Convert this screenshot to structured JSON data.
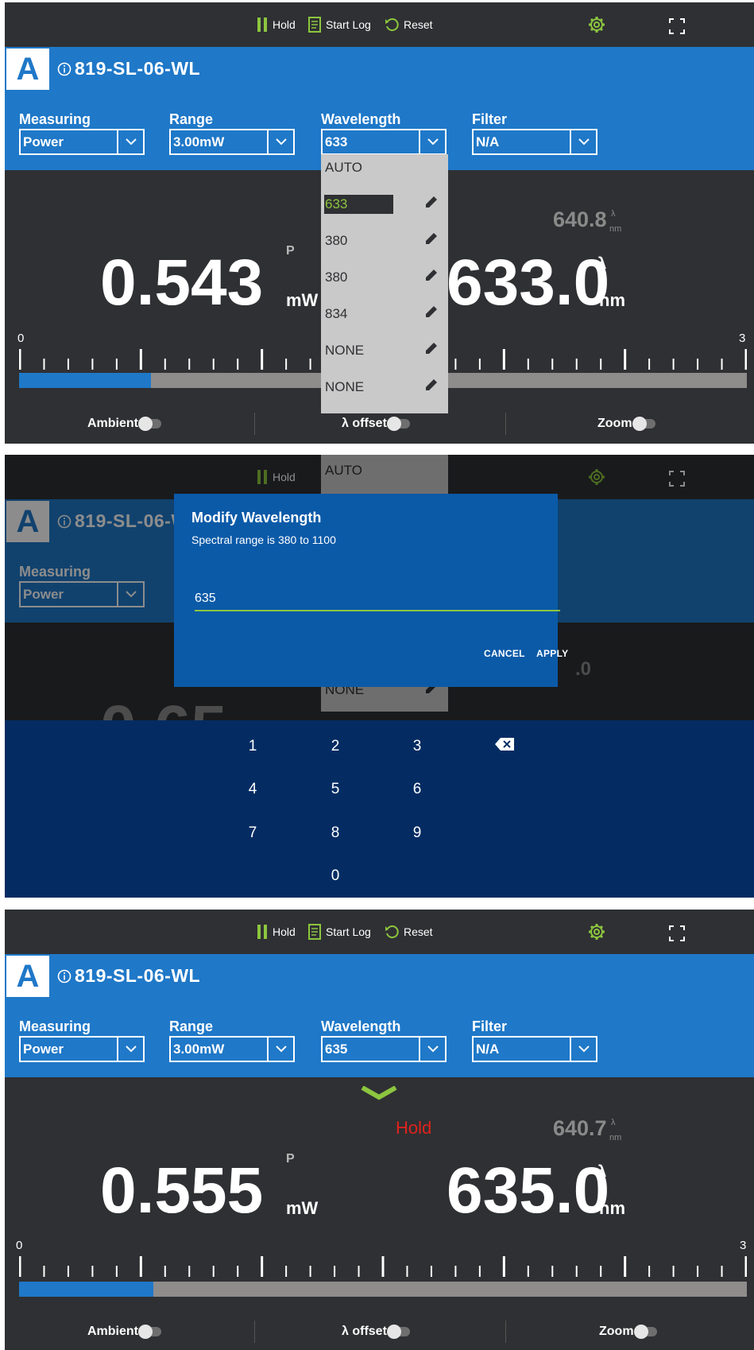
{
  "toolbar": {
    "hold_label": "Hold",
    "start_log_label": "Start Log",
    "reset_label": "Reset"
  },
  "colors": {
    "brand_blue": "#1f78c8",
    "accent_green": "#8cc63f",
    "background": "#2f3033",
    "hold_red": "#e0231b"
  },
  "header": {
    "logo_letter": "A",
    "device_name": "819-SL-06-WL",
    "labels": {
      "measuring": "Measuring",
      "range": "Range",
      "wavelength": "Wavelength",
      "filter": "Filter"
    }
  },
  "screen1": {
    "selects": {
      "measuring": "Power",
      "range": "3.00mW",
      "wavelength": "633",
      "filter": "N/A"
    },
    "power_reading": "0.543",
    "power_unit": "mW",
    "power_marker": "P",
    "wavelength_reading": "633.0",
    "wavelength_unit": "nm",
    "wavelength_marker": "λ",
    "secondary_reading": "640.8",
    "secondary_unit": "nm",
    "secondary_marker": "λ",
    "wavelength_options": [
      "AUTO",
      "633",
      "380",
      "380",
      "834",
      "NONE",
      "NONE"
    ],
    "scale_min": "0",
    "scale_max": "3",
    "bar_fraction": 0.181
  },
  "screen2": {
    "selects": {
      "measuring": "Power"
    },
    "background_dropdown_top": "AUTO",
    "background_dropdown_item": "NONE",
    "secondary_fragment": ".0",
    "dialog": {
      "title": "Modify Wavelength",
      "subtitle": "Spectral range is 380 to 1100",
      "input_value": "635",
      "cancel_label": "CANCEL",
      "apply_label": "APPLY"
    },
    "keypad": {
      "keys": [
        "1",
        "2",
        "3",
        "4",
        "5",
        "6",
        "7",
        "8",
        "9",
        "0"
      ]
    }
  },
  "screen3": {
    "selects": {
      "measuring": "Power",
      "range": "3.00mW",
      "wavelength": "635",
      "filter": "N/A"
    },
    "hold_status": "Hold",
    "power_reading": "0.555",
    "power_unit": "mW",
    "power_marker": "P",
    "wavelength_reading": "635.0",
    "wavelength_unit": "nm",
    "wavelength_marker": "λ",
    "secondary_reading": "640.7",
    "secondary_unit": "nm",
    "secondary_marker": "λ",
    "scale_min": "0",
    "scale_max": "3",
    "bar_fraction": 0.185
  },
  "toggles": {
    "ambient": "Ambient",
    "lambda_offset": "λ offset",
    "zoom": "Zoom"
  }
}
